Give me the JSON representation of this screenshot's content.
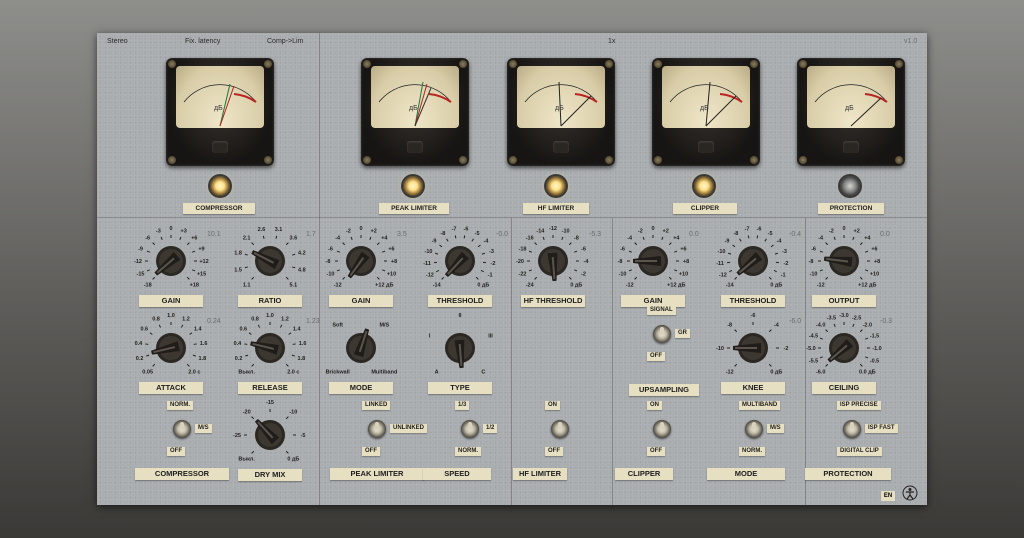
{
  "header": {
    "mode": "Stereo",
    "latency": "Fix. latency",
    "chain": "Comp->Lim",
    "oversampling": "1x",
    "version": "v1.0"
  },
  "meter_unit": "дБ",
  "indicators": [
    {
      "label": "COMPRESSOR",
      "lit": true
    },
    {
      "label": "PEAK LIMITER",
      "lit": true
    },
    {
      "label": "HF LIMITER",
      "lit": true
    },
    {
      "label": "CLIPPER",
      "lit": true
    },
    {
      "label": "PROTECTION",
      "lit": false
    }
  ],
  "knobs": {
    "comp_gain": {
      "label": "GAIN",
      "value": "10.1",
      "ticks": [
        "-18",
        "-15",
        "-12",
        "-9",
        "-6",
        "-3",
        "0",
        "+3",
        "+6",
        "+9",
        "+12",
        "+15",
        "+18"
      ],
      "unit": "дБ"
    },
    "comp_ratio": {
      "label": "RATIO",
      "value": "1.7",
      "ticks": [
        "1.1",
        "1.5",
        "1.8",
        "2.1",
        "2.6",
        "3.1",
        "3.6",
        "4.2",
        "4.8",
        "5.1"
      ]
    },
    "comp_attack": {
      "label": "ATTACK",
      "value": "0.24",
      "ticks": [
        "0.05",
        "0.2",
        "0.4",
        "0.6",
        "0.8",
        "1.0",
        "1.2",
        "1.4",
        "1.6",
        "1.8",
        "2.0 с"
      ]
    },
    "comp_release": {
      "label": "RELEASE",
      "value": "1.23",
      "ticks": [
        "Выкл.",
        "0.2",
        "0.4",
        "0.6",
        "0.8",
        "1.0",
        "1.2",
        "1.4",
        "1.6",
        "1.8",
        "2.0 с"
      ]
    },
    "dry_mix": {
      "label": "DRY MIX",
      "ticks": [
        "Выкл.",
        "-25",
        "-20",
        "-15",
        "-10",
        "-5",
        "0 дБ"
      ]
    },
    "pl_gain": {
      "label": "GAIN",
      "value": "3.5",
      "ticks": [
        "-12",
        "-10",
        "-8",
        "-6",
        "-4",
        "-2",
        "0",
        "+2",
        "+4",
        "+6",
        "+8",
        "+10",
        "+12 дБ"
      ]
    },
    "pl_threshold": {
      "label": "THRESHOLD",
      "value": "-0.0",
      "ticks": [
        "-14",
        "-12",
        "-11",
        "-10",
        "-9",
        "-8",
        "-7",
        "-6",
        "-5",
        "-4",
        "-3",
        "-2",
        "-1",
        "0 дБ"
      ]
    },
    "pl_mode": {
      "label": "MODE",
      "ticks": [
        "Brickwall",
        "Soft",
        "M/S",
        "Multiband"
      ]
    },
    "pl_type": {
      "label": "TYPE",
      "ticks": [
        "A",
        "I",
        "II",
        "III",
        "C"
      ]
    },
    "hf_threshold": {
      "label": "HF THRESHOLD",
      "value": "-5.3",
      "ticks": [
        "-24",
        "-22",
        "-20",
        "-18",
        "-16",
        "-14",
        "-12",
        "-10",
        "-8",
        "-6",
        "-4",
        "-2",
        "0 дБ"
      ]
    },
    "cl_gain": {
      "label": "GAIN",
      "value": "0.0",
      "ticks": [
        "-12",
        "-10",
        "-8",
        "-6",
        "-4",
        "-2",
        "0",
        "+2",
        "+4",
        "+6",
        "+8",
        "+10",
        "+12 дБ"
      ]
    },
    "cl_threshold": {
      "label": "THRESHOLD",
      "value": "-0.4",
      "ticks": [
        "-14",
        "-12",
        "-11",
        "-10",
        "-9",
        "-8",
        "-7",
        "-6",
        "-5",
        "-4",
        "-3",
        "-2",
        "-1",
        "0 дБ"
      ]
    },
    "cl_knee": {
      "label": "KNEE",
      "value": "-6.0",
      "ticks": [
        "-12",
        "-10",
        "-8",
        "-6",
        "-4",
        "-2",
        "0 дБ"
      ]
    },
    "out_output": {
      "label": "OUTPUT",
      "value": "0.0",
      "ticks": [
        "-12",
        "-10",
        "-8",
        "-6",
        "-4",
        "-2",
        "0",
        "+2",
        "+4",
        "+6",
        "+8",
        "+10",
        "+12 дБ"
      ]
    },
    "out_ceiling": {
      "label": "CEILING",
      "value": "-0.3",
      "ticks": [
        "-6.0",
        "-5.5",
        "-5.0",
        "-4.5",
        "-4.0",
        "-3.5",
        "-3.0",
        "-2.5",
        "-2.0",
        "-1.5",
        "-1.0",
        "-0.5",
        "0.0 дБ"
      ]
    }
  },
  "switches": {
    "comp_sw": {
      "top": "NORM.",
      "side": "M/S",
      "bottom": "OFF",
      "label": "COMPRESSOR"
    },
    "pl_sw": {
      "top": "LINKED",
      "side": "UNLINKED",
      "bottom": "OFF",
      "label": "PEAK LIMITER"
    },
    "speed_sw": {
      "top": "1/3",
      "side": "1/2",
      "bottom": "NORM.",
      "label": "SPEED"
    },
    "hf_sw": {
      "top": "ON",
      "bottom": "OFF",
      "label": "HF LIMITER"
    },
    "ups_sw": {
      "top": "SIGNAL",
      "side": "GR",
      "bottom": "OFF",
      "label": "UPSAMPLING"
    },
    "clip_sw": {
      "top": "ON",
      "bottom": "OFF",
      "label": "CLIPPER"
    },
    "mode_sw": {
      "top": "MULTIBAND",
      "side": "M/S",
      "bottom": "NORM.",
      "label": "MODE"
    },
    "prot_sw": {
      "top": "ISP PRECISE",
      "side": "ISP FAST",
      "bottom": "DIGITAL CLIP",
      "label": "PROTECTION"
    }
  },
  "footer": {
    "language": "EN"
  }
}
